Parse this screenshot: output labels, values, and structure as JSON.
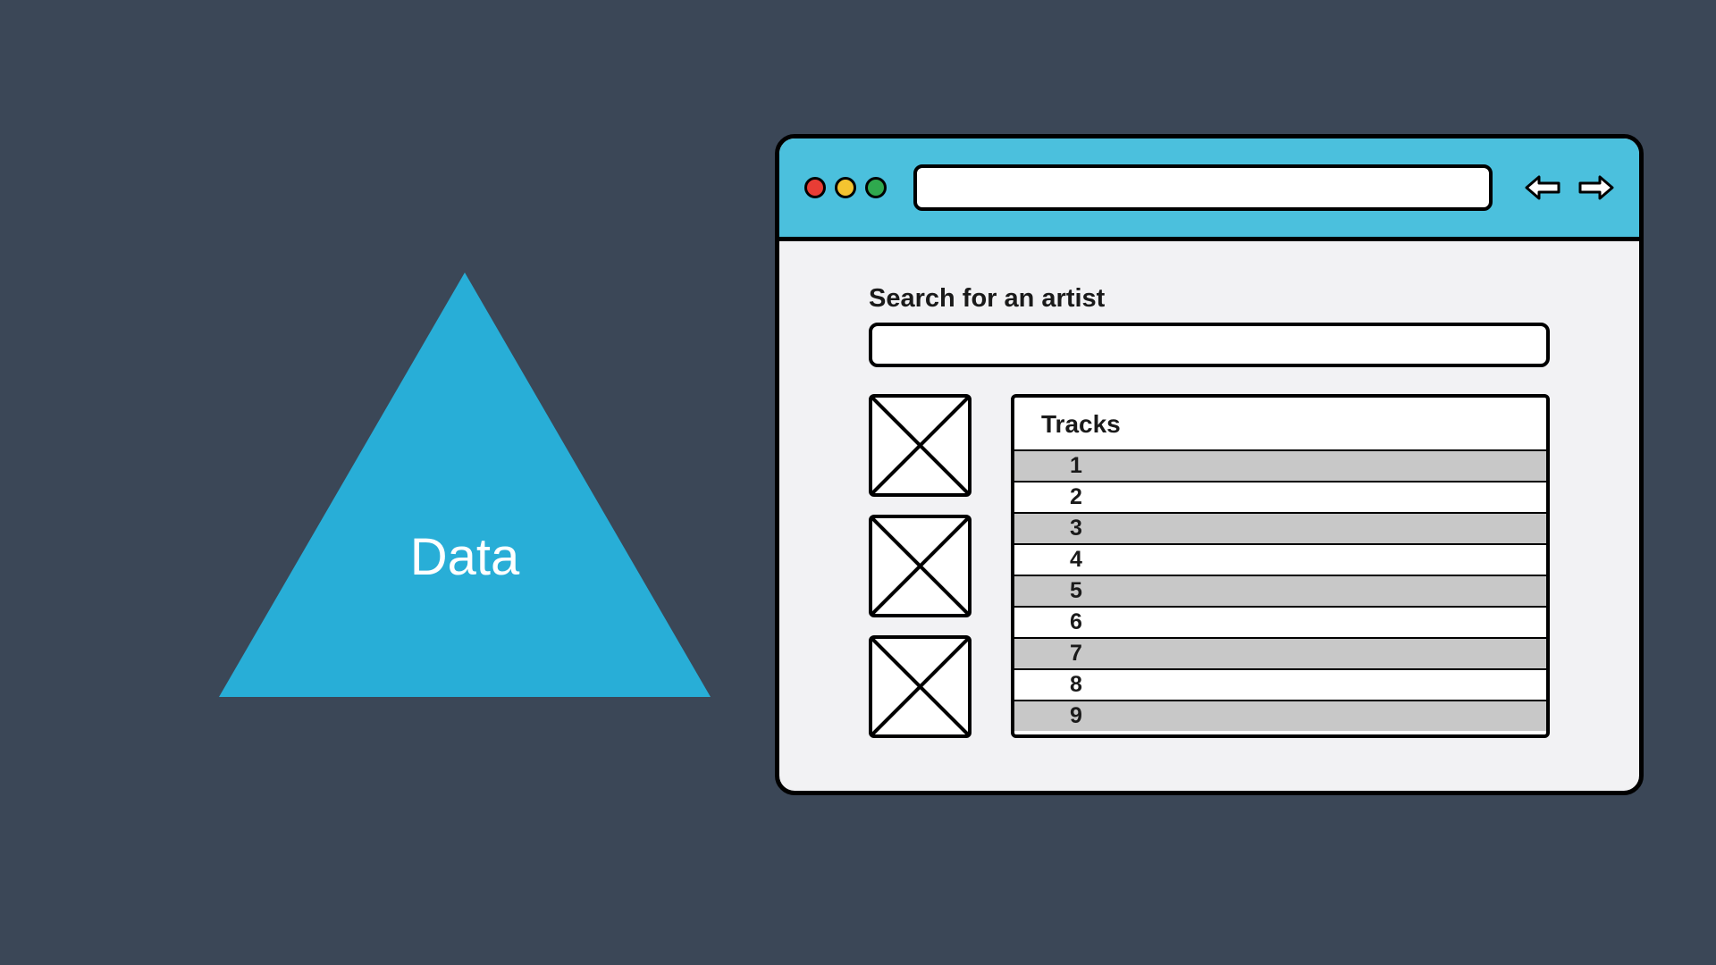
{
  "triangle": {
    "label": "Data"
  },
  "browser": {
    "address_bar_value": "",
    "search_label": "Search for an artist",
    "search_value": "",
    "tracks_header": "Tracks",
    "tracks": [
      "1",
      "2",
      "3",
      "4",
      "5",
      "6",
      "7",
      "8",
      "9"
    ]
  },
  "colors": {
    "background": "#3b4757",
    "triangle_fill": "#28aed7",
    "titlebar": "#4bc0dd",
    "traffic_red": "#e83d35",
    "traffic_yellow": "#f4c430",
    "traffic_green": "#2fa94e"
  }
}
